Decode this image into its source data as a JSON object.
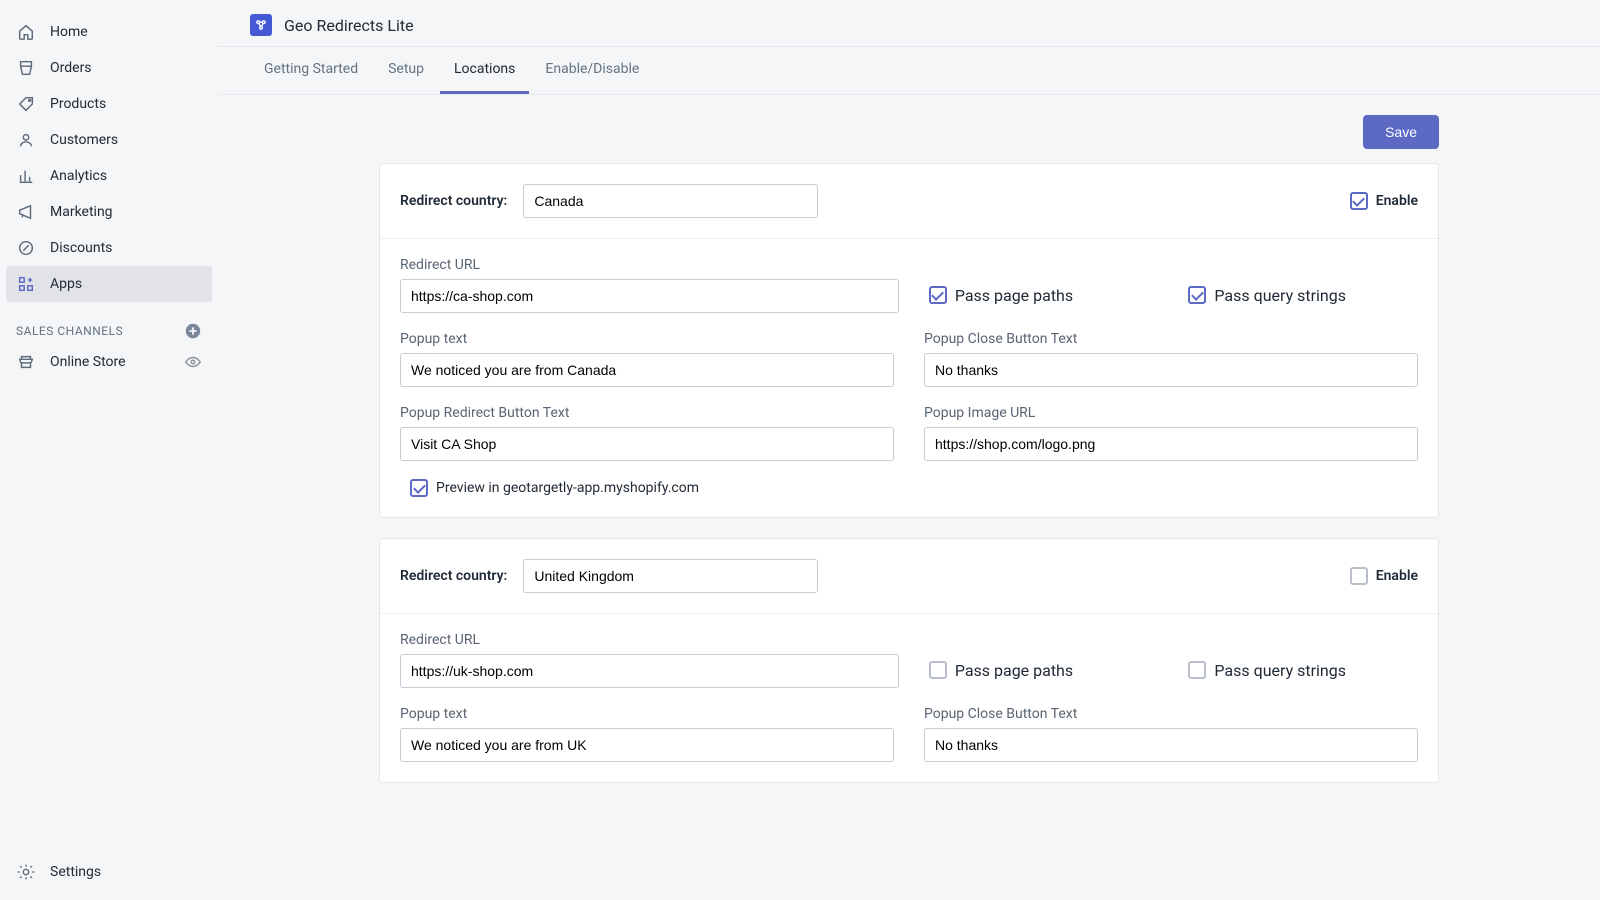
{
  "sidebar": {
    "items": [
      {
        "label": "Home",
        "icon": "home"
      },
      {
        "label": "Orders",
        "icon": "orders"
      },
      {
        "label": "Products",
        "icon": "products"
      },
      {
        "label": "Customers",
        "icon": "customers"
      },
      {
        "label": "Analytics",
        "icon": "analytics"
      },
      {
        "label": "Marketing",
        "icon": "marketing"
      },
      {
        "label": "Discounts",
        "icon": "discounts"
      },
      {
        "label": "Apps",
        "icon": "apps"
      }
    ],
    "section_label": "SALES CHANNELS",
    "channel_label": "Online Store",
    "settings_label": "Settings"
  },
  "app": {
    "title": "Geo Redirects Lite"
  },
  "tabs": [
    "Getting Started",
    "Setup",
    "Locations",
    "Enable/Disable"
  ],
  "save_label": "Save",
  "labels": {
    "redirect_country": "Redirect country:",
    "enable": "Enable",
    "redirect_url": "Redirect URL",
    "pass_paths": "Pass page paths",
    "pass_query": "Pass query strings",
    "popup_text": "Popup text",
    "popup_close": "Popup Close Button Text",
    "popup_redirect": "Popup Redirect Button Text",
    "popup_image": "Popup Image URL",
    "preview": "Preview in geotargetly-app.myshopify.com"
  },
  "cards": [
    {
      "country": "Canada",
      "enable": true,
      "url": "https://ca-shop.com",
      "pass_paths": true,
      "pass_query": true,
      "popup_text": "We noticed you are from Canada",
      "popup_close": "No thanks",
      "popup_redirect": "Visit CA Shop",
      "popup_image": "https://shop.com/logo.png",
      "preview": true
    },
    {
      "country": "United Kingdom",
      "enable": false,
      "url": "https://uk-shop.com",
      "pass_paths": false,
      "pass_query": false,
      "popup_text": "We noticed you are from UK",
      "popup_close": "No thanks"
    }
  ]
}
